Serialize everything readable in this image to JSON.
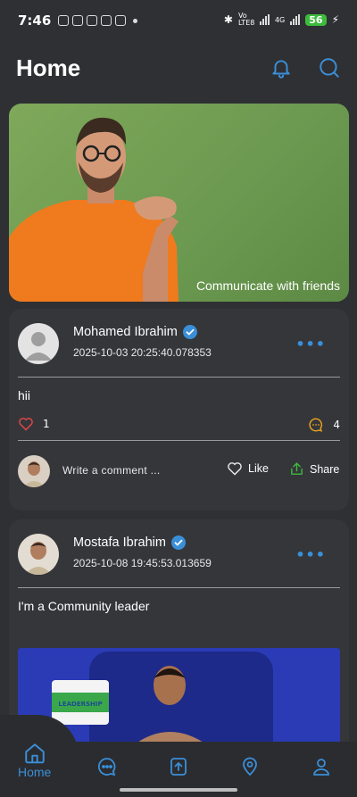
{
  "status_bar": {
    "time": "7:46",
    "network_label": "Vo LTE8",
    "network_label_2": "4G",
    "battery": "56"
  },
  "header": {
    "title": "Home",
    "icons": [
      "bell-icon",
      "search-icon"
    ]
  },
  "banner": {
    "caption": "Communicate with friends"
  },
  "posts": [
    {
      "author": "Mohamed Ibrahim",
      "verified": true,
      "timestamp": "2025-10-03 20:25:40.078353",
      "text": "hii",
      "likes": "1",
      "comments": "4",
      "comment_placeholder": "Write a comment ...",
      "like_label": "Like",
      "share_label": "Share"
    },
    {
      "author": "Mostafa Ibrahim",
      "verified": true,
      "timestamp": "2025-10-08 19:45:53.013659",
      "text": "I'm a Community leader",
      "image_badge": "LEADERSHIP"
    }
  ],
  "bottom_nav": {
    "items": [
      {
        "label": "Home",
        "icon": "home-icon",
        "active": true
      },
      {
        "icon": "chat-icon"
      },
      {
        "icon": "upload-icon"
      },
      {
        "icon": "location-icon"
      },
      {
        "icon": "profile-icon"
      }
    ]
  },
  "colors": {
    "background": "#2f3034",
    "card": "#35363a",
    "accent": "#3a8fd8",
    "like": "#e04848",
    "comment": "#e0a020",
    "share": "#3dbb3d"
  }
}
